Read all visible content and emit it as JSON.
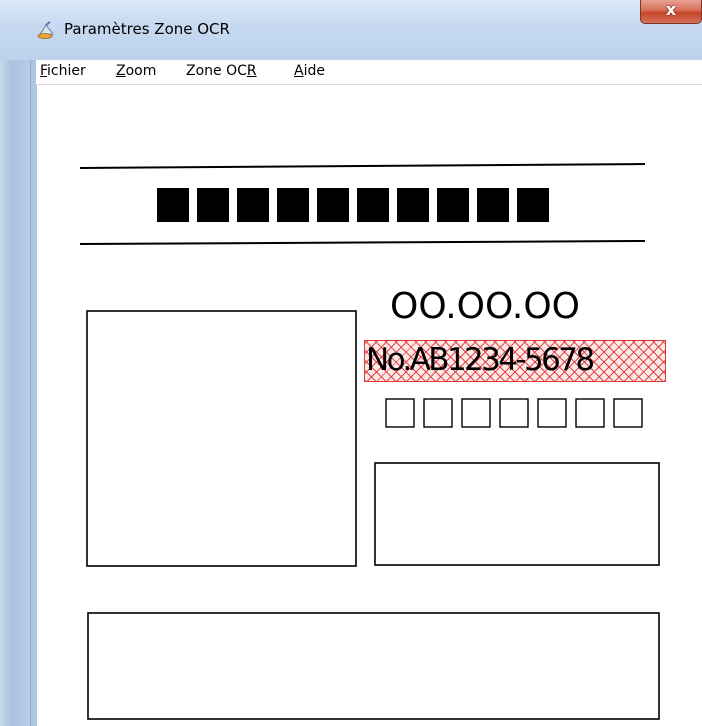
{
  "window": {
    "title": "Paramètres Zone OCR",
    "close_label": "x"
  },
  "menu": {
    "items": [
      {
        "label": "Fichier",
        "mnemonic": "F"
      },
      {
        "label": "Zoom",
        "mnemonic": "Z"
      },
      {
        "label": "Zone OCR",
        "mnemonic": "R"
      },
      {
        "label": "Aide",
        "mnemonic": "A"
      }
    ]
  },
  "document": {
    "title_block_count": 10,
    "date_text": "OO.OO.OO",
    "number_text": "No.AB1234-5678",
    "checkbox_count": 7,
    "ocr_zone_color": "#e03838"
  }
}
